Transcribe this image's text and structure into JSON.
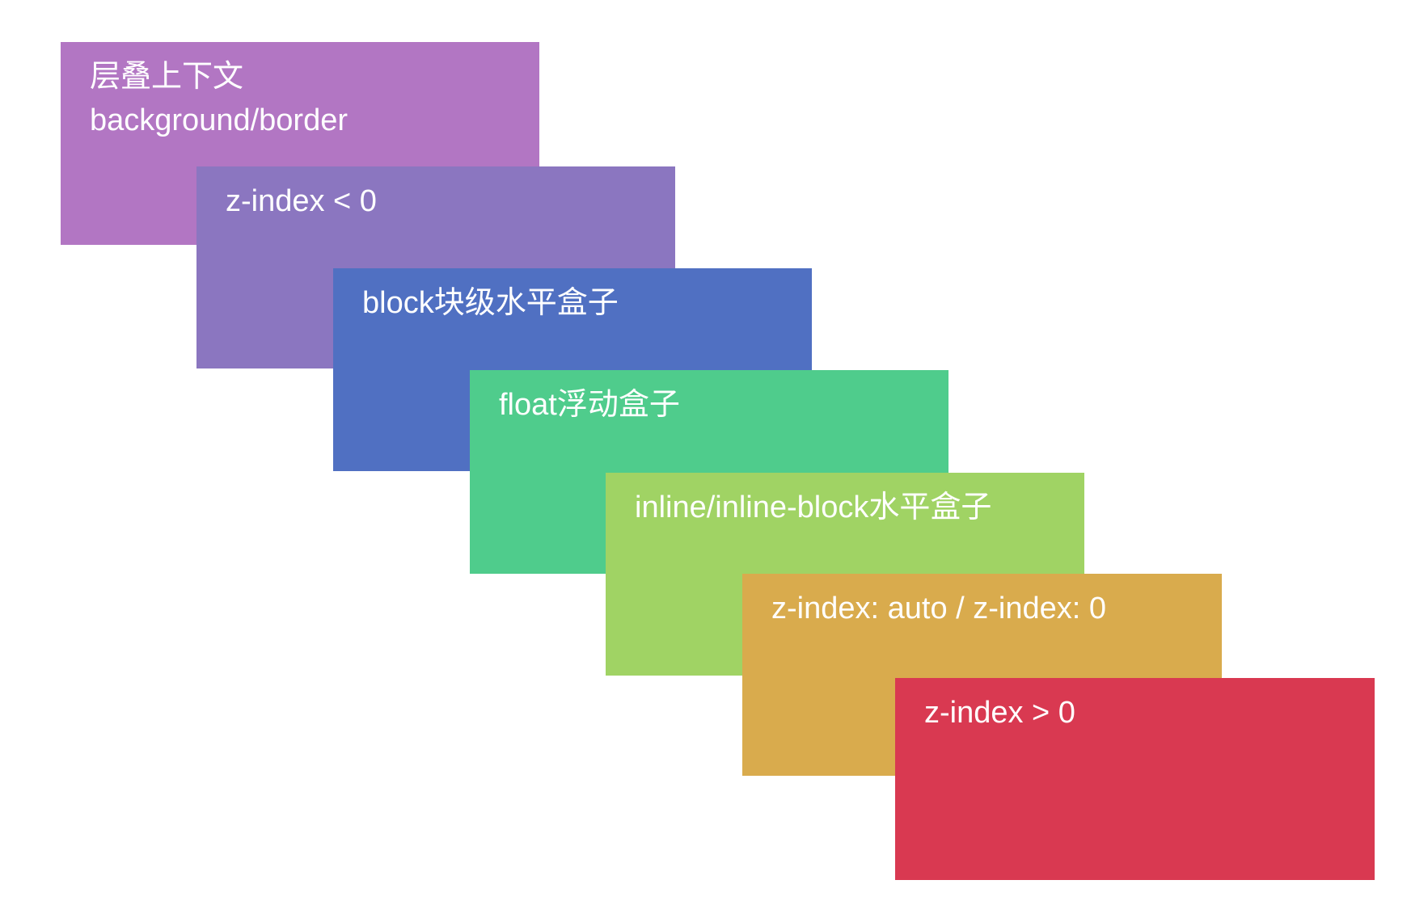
{
  "layers": [
    {
      "lines": [
        "层叠上下文",
        "background/border"
      ],
      "color": "#B276C3"
    },
    {
      "lines": [
        "z-index < 0"
      ],
      "color": "#8B76C0"
    },
    {
      "lines": [
        "block块级水平盒子"
      ],
      "color": "#5070C2"
    },
    {
      "lines": [
        "float浮动盒子"
      ],
      "color": "#4FCC8C"
    },
    {
      "lines": [
        "inline/inline-block水平盒子"
      ],
      "color": "#A0D364"
    },
    {
      "lines": [
        "z-index: auto / z-index: 0"
      ],
      "color": "#D9AB4D"
    },
    {
      "lines": [
        "z-index > 0"
      ],
      "color": "#D93951"
    }
  ],
  "text_color": "#FFFFFF"
}
